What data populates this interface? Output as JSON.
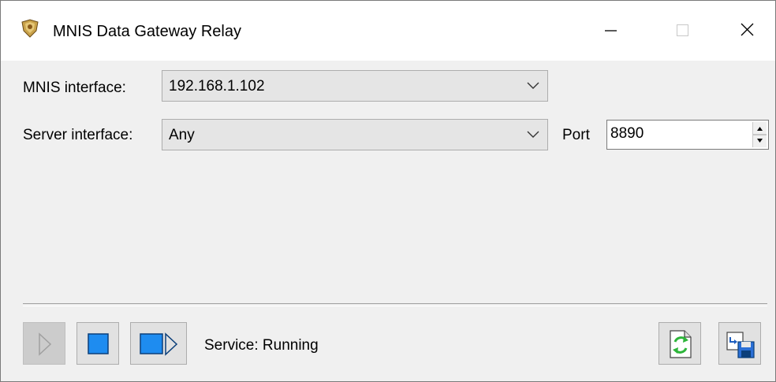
{
  "window": {
    "title": "MNIS Data Gateway Relay",
    "icon": "gateway-app-icon",
    "controls": [
      "minimize-icon",
      "maximize-icon",
      "close-icon"
    ]
  },
  "form": {
    "mnis_label": "MNIS interface:",
    "mnis_value": "192.168.1.102",
    "server_label": "Server interface:",
    "server_value": "Any",
    "port_label": "Port",
    "port_value": "8890"
  },
  "toolbar": {
    "start_icon": "play-icon",
    "stop_icon": "stop-icon",
    "restart_icon": "restart-icon",
    "status_text": "Service: Running",
    "refresh_icon": "refresh-icon",
    "save_icon": "save-icon"
  },
  "colors": {
    "accent_blue": "#1e8cf0",
    "refresh_green": "#2db53a"
  }
}
